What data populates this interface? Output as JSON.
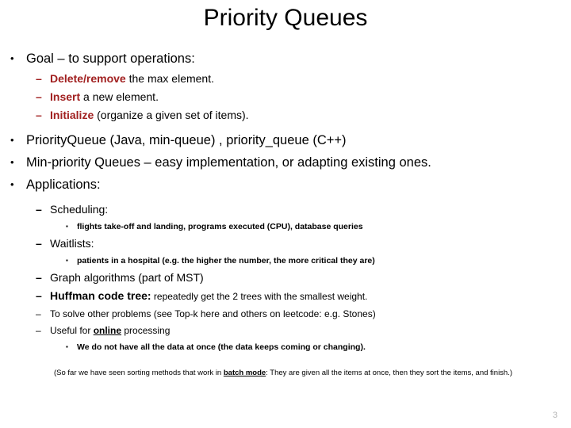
{
  "slide": {
    "title": "Priority Queues",
    "page_number": "3",
    "accent_red": "#A12020",
    "bullets": {
      "dot": "•",
      "dash": "–",
      "square": "▪"
    },
    "items": [
      {
        "id": "goal",
        "level": 1,
        "text": "Goal – to support operations:"
      },
      {
        "id": "delete",
        "level": 2,
        "lead": "Delete/remove",
        "rest": " the max element."
      },
      {
        "id": "insert",
        "level": 2,
        "lead": "Insert",
        "rest": " a new element."
      },
      {
        "id": "initialize",
        "level": 2,
        "lead": "Initialize",
        "rest": " (organize a given set of items)."
      },
      {
        "id": "priorityqueue",
        "level": 1,
        "text": "PriorityQueue (Java, min-queue) , priority_queue (C++)"
      },
      {
        "id": "minpriority",
        "level": 1,
        "text": "Min-priority Queues – easy implementation, or adapting existing ones."
      },
      {
        "id": "applications",
        "level": 1,
        "text": "Applications:"
      },
      {
        "id": "scheduling",
        "level": 2,
        "text": "Scheduling:"
      },
      {
        "id": "scheduling-detail",
        "level": 3,
        "text": "flights take-off and landing, programs executed (CPU), database queries"
      },
      {
        "id": "waitlists",
        "level": 2,
        "text": "Waitlists:"
      },
      {
        "id": "waitlists-detail",
        "level": 3,
        "text": "patients in a hospital (e.g. the higher the number, the more critical they are)"
      },
      {
        "id": "graph-algorithms",
        "level": 2,
        "text": "Graph algorithms (part of MST)"
      },
      {
        "id": "huffman",
        "level": 2,
        "lead": "Huffman code tree:",
        "rest": " repeatedly get the 2 trees with the smallest weight."
      },
      {
        "id": "other-problems",
        "level": 2,
        "text": "To solve other problems (see Top-k here and others on leetcode:  e.g. Stones)"
      },
      {
        "id": "online",
        "level": 2,
        "pre": "Useful for ",
        "emph": "online",
        "post": " processing"
      },
      {
        "id": "online-detail",
        "level": 3,
        "text": "We do not have all the data at once (the data keeps coming or changing)."
      }
    ],
    "note": {
      "pre": "(So far we have seen sorting methods that work in ",
      "emph": "batch mode",
      "post": ": They are given all the items at once, then they sort the items, and finish.)"
    }
  }
}
